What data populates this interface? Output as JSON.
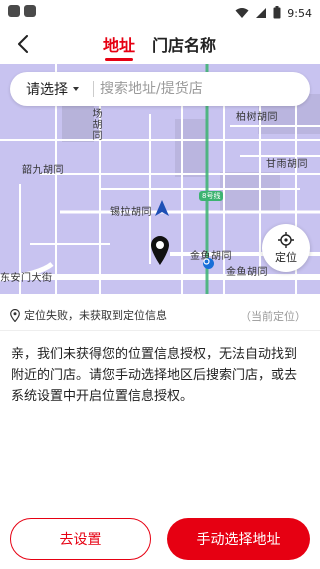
{
  "status_bar": {
    "time": "9:54",
    "icons": [
      "wifi-icon",
      "signal-icon",
      "battery-icon"
    ]
  },
  "header": {
    "tabs": [
      {
        "label": "地址",
        "active": true
      },
      {
        "label": "门店名称",
        "active": false
      }
    ]
  },
  "search": {
    "region_label": "请选择",
    "placeholder": "搜索地址/提货店"
  },
  "map": {
    "labels": {
      "bohu": "柏树胡同",
      "ganyu": "甘雨胡同",
      "shaojiu": "韶九胡同",
      "xila": "锡拉胡同",
      "jinyu": "金鱼胡同",
      "jinyu2": "金鱼胡同",
      "dongan": "东安门大街",
      "vertical": "场胡同"
    },
    "line_badge": "8号线",
    "locate_label": "定位"
  },
  "panel": {
    "location_status": "定位失败，未获取到定位信息",
    "current_location": "（当前定位）",
    "message": "亲，我们未获得您的位置信息授权，无法自动找到附近的门店。请您手动选择地区后搜索门店，或去系统设置中开启位置信息授权。",
    "settings_button": "去设置",
    "manual_button": "手动选择地址"
  },
  "colors": {
    "accent": "#e60012",
    "map_bg": "#c8c3f0",
    "road": "#ffffff",
    "metro_line": "#3cb371"
  }
}
